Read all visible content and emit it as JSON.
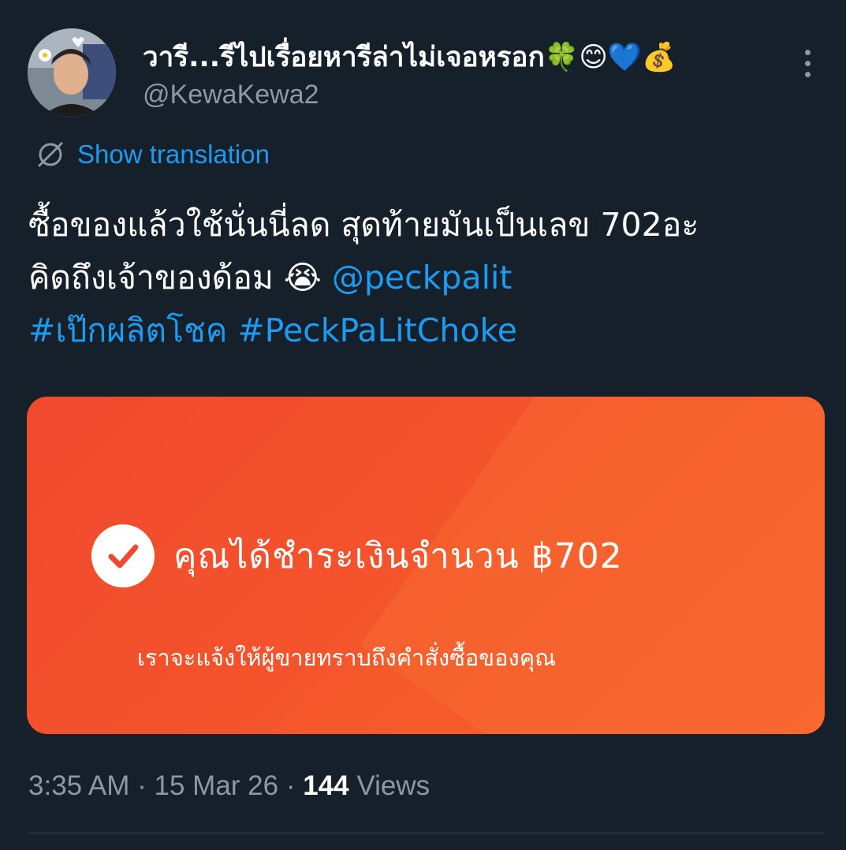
{
  "tweet": {
    "display_name": "วารี...รีไปเรื่อยหารีล่าไม่เจอหรอก🍀😊💙💰",
    "handle": "@KewaKewa2",
    "show_translation": "Show translation",
    "text_line1": "ซื้อของแล้วใช้นั่นนี่ลด สุดท้ายมันเป็นเลข 702อะ",
    "text_line2": "คิดถึงเจ้าของด้อม 😭 ",
    "mention": "@peckpalit",
    "hashtag1": "#เป๊กผลิตโชค",
    "hashtag2": "#PeckPaLitChoke",
    "icons": {
      "more": "more-vertical-icon",
      "translate": "translate-icon",
      "check": "check-circle-icon"
    }
  },
  "media": {
    "payment_text": "คุณได้ชำระเงินจำนวน ฿702",
    "notify_text": "เราจะแจ้งให้ผู้ขายทราบถึงคำสั่งซื้อของคุณ",
    "background_color": "#f4532c"
  },
  "meta": {
    "time": "3:35 AM",
    "separator": " · ",
    "date": "15 Mar 26",
    "views_count": "144",
    "views_label": " Views"
  },
  "colors": {
    "background": "#15202b",
    "link": "#1d9bf0",
    "secondary_text": "#8b98a5"
  }
}
